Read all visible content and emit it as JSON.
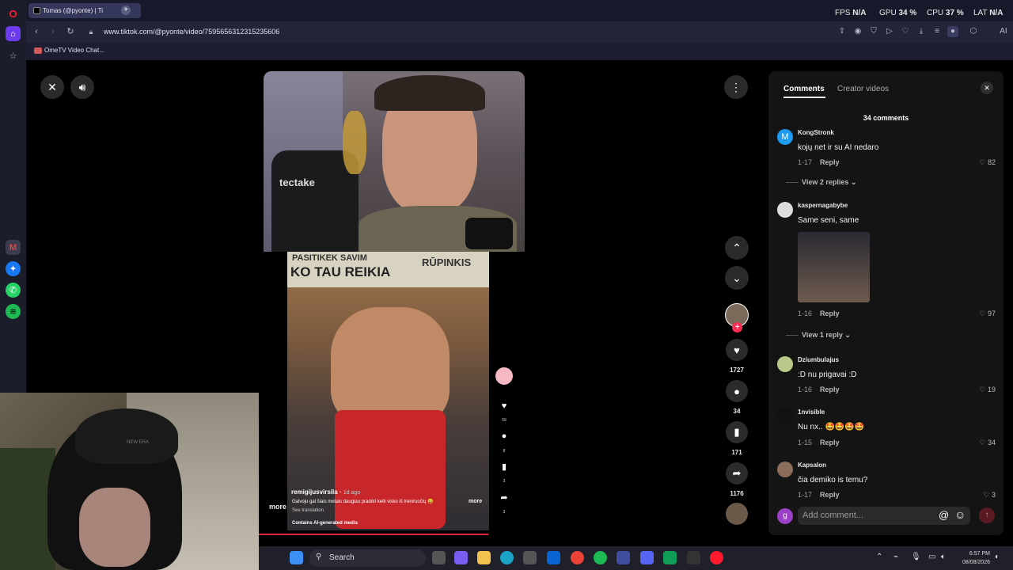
{
  "browser": {
    "tab_title": "Tomas (@pyonte) | Ti",
    "url": "www.tiktok.com/@pyonte/video/7595656312315235606",
    "bookmark": "OmeTV Video Chat..."
  },
  "stats": {
    "fps_label": "FPS",
    "fps_value": "N/A",
    "gpu_label": "GPU",
    "gpu_value": "34 %",
    "cpu_label": "CPU",
    "cpu_value": "37 %",
    "lat_label": "LAT",
    "lat_value": "N/A"
  },
  "actions": {
    "likes": "1727",
    "comments": "34",
    "saves": "171",
    "shares": "1176"
  },
  "inner_video": {
    "author": "remigijusvirsila",
    "time": "1d ago",
    "caption": "Galvoju gal šiais metais daugiau pradėti kelti visko iš treniruočių 😄",
    "more": "more",
    "see_translation": "See translation",
    "ai_label": "Contains AI-generated media",
    "likes": "59",
    "comments": "8",
    "saves": "3",
    "shares": "3",
    "gym_sign_left": "PASITIKEK SAVIM",
    "gym_sign_mid": "KO TAU REIKIA",
    "gym_sign_right": "RŪPINKIS",
    "outer_more": "more"
  },
  "comments_panel": {
    "tab_comments": "Comments",
    "tab_creator": "Creator videos",
    "count": "34 comments",
    "add_placeholder": "Add comment...",
    "input_avatar": "g",
    "items": [
      {
        "user": "KongStronk",
        "avatar_letter": "M",
        "text": "kojų net ir su AI nedaro",
        "date": "1-17",
        "reply": "Reply",
        "likes": "82",
        "view_replies": "View 2 replies"
      },
      {
        "user": "kaspernagabybe",
        "text": "Same seni, same",
        "date": "1-16",
        "reply": "Reply",
        "likes": "97",
        "view_replies": "View 1 reply"
      },
      {
        "user": "Dziumbulajus",
        "text": ":D nu prigavai :D",
        "date": "1-16",
        "reply": "Reply",
        "likes": "19"
      },
      {
        "user": "1nvisible",
        "text": "Nu nx.. 🤩🤩🤩🤩",
        "date": "1-15",
        "reply": "Reply",
        "likes": "34"
      },
      {
        "user": "Kapsalon",
        "text": "čia demiko is temu?",
        "date": "1-17",
        "reply": "Reply",
        "likes": "3"
      }
    ]
  },
  "webcam_overlay": {
    "cap_brand": "NEW ERA"
  },
  "video_overlay": {
    "brand": "tectake"
  },
  "taskbar": {
    "search": "Search",
    "time": "6:57 PM",
    "date": "08/08/2026"
  },
  "colors": {
    "accent_red": "#e0243c",
    "opera_red": "#ff1b2d",
    "panel_bg": "#141414"
  }
}
